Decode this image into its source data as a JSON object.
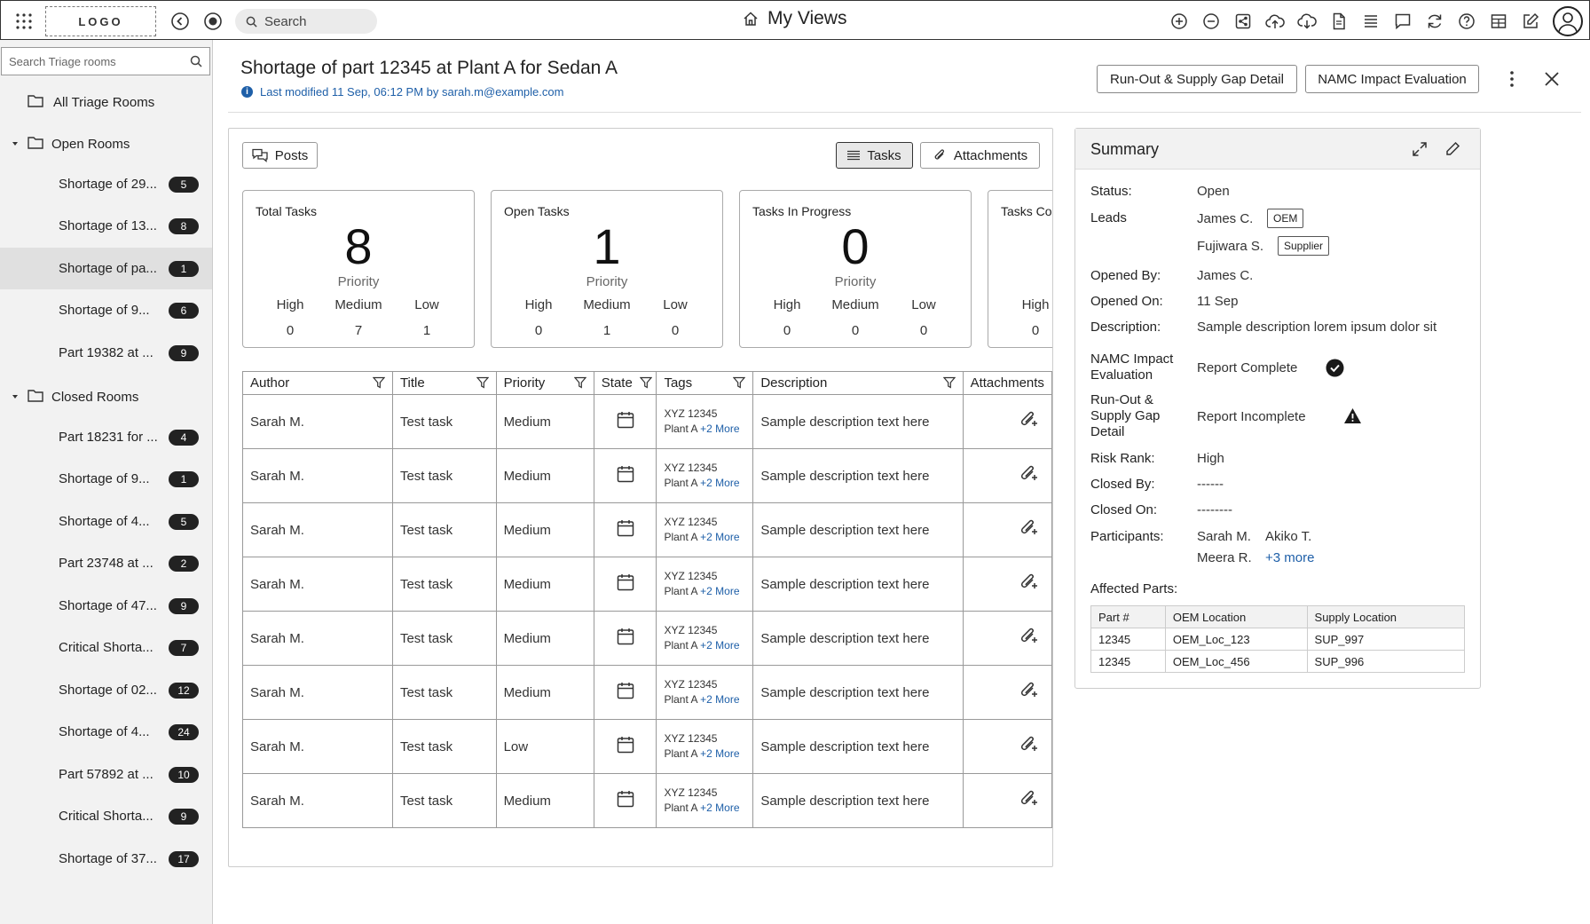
{
  "topbar": {
    "logo": "LOGO",
    "search_placeholder": "Search",
    "title": "My Views"
  },
  "sidebar": {
    "search_placeholder": "Search Triage rooms",
    "all_rooms": "All Triage Rooms",
    "open_group": "Open Rooms",
    "closed_group": "Closed Rooms",
    "open_items": [
      {
        "label": "Shortage of 29...",
        "count": "5"
      },
      {
        "label": "Shortage of 13...",
        "count": "8"
      },
      {
        "label": "Shortage of pa...",
        "count": "1"
      },
      {
        "label": "Shortage of 9...",
        "count": "6"
      },
      {
        "label": "Part 19382 at ...",
        "count": "9"
      }
    ],
    "closed_items": [
      {
        "label": "Part 18231 for ...",
        "count": "4"
      },
      {
        "label": "Shortage of 9...",
        "count": "1"
      },
      {
        "label": "Shortage of 4...",
        "count": "5"
      },
      {
        "label": "Part 23748 at ...",
        "count": "2"
      },
      {
        "label": "Shortage of 47...",
        "count": "9"
      },
      {
        "label": "Critical Shorta...",
        "count": "7"
      },
      {
        "label": "Shortage of 02...",
        "count": "12"
      },
      {
        "label": "Shortage of 4...",
        "count": "24"
      },
      {
        "label": "Part 57892 at ...",
        "count": "10"
      },
      {
        "label": "Critical Shorta...",
        "count": "9"
      },
      {
        "label": "Shortage of 37...",
        "count": "17"
      }
    ]
  },
  "header": {
    "title": "Shortage of part 12345 at Plant A for Sedan A",
    "modified": "Last modified 11 Sep, 06:12 PM by sarah.m@example.com",
    "btn_runout": "Run-Out & Supply Gap Detail",
    "btn_namc": "NAMC Impact Evaluation"
  },
  "main": {
    "posts": "Posts",
    "tab_tasks": "Tasks",
    "tab_attachments": "Attachments",
    "cards": [
      {
        "label": "Total Tasks",
        "value": "8",
        "priority": "Priority",
        "high": "0",
        "medium": "7",
        "low": "1"
      },
      {
        "label": "Open Tasks",
        "value": "1",
        "priority": "Priority",
        "high": "0",
        "medium": "1",
        "low": "0"
      },
      {
        "label": "Tasks In Progress",
        "value": "0",
        "priority": "Priority",
        "high": "0",
        "medium": "0",
        "low": "0"
      },
      {
        "label": "Tasks Completed",
        "value": "",
        "priority": "",
        "high": "0",
        "medium": "",
        "low": ""
      }
    ],
    "prio_labels": {
      "high": "High",
      "medium": "Medium",
      "low": "Low"
    },
    "columns": [
      "Author",
      "Title",
      "Priority",
      "State",
      "Tags",
      "Description",
      "Attachments"
    ],
    "rows": [
      {
        "author": "Sarah M.",
        "title": "Test task",
        "priority": "Medium",
        "tag1": "XYZ 12345",
        "tag2": "Plant A",
        "more": "+2 More",
        "desc": "Sample description text here"
      },
      {
        "author": "Sarah M.",
        "title": "Test task",
        "priority": "Medium",
        "tag1": "XYZ 12345",
        "tag2": "Plant A",
        "more": "+2 More",
        "desc": "Sample description text here"
      },
      {
        "author": "Sarah M.",
        "title": "Test task",
        "priority": "Medium",
        "tag1": "XYZ 12345",
        "tag2": "Plant A",
        "more": "+2 More",
        "desc": "Sample description text here"
      },
      {
        "author": "Sarah M.",
        "title": "Test task",
        "priority": "Medium",
        "tag1": "XYZ 12345",
        "tag2": "Plant A",
        "more": "+2 More",
        "desc": "Sample description text here"
      },
      {
        "author": "Sarah M.",
        "title": "Test task",
        "priority": "Medium",
        "tag1": "XYZ 12345",
        "tag2": "Plant A",
        "more": "+2 More",
        "desc": "Sample description text here"
      },
      {
        "author": "Sarah M.",
        "title": "Test task",
        "priority": "Medium",
        "tag1": "XYZ 12345",
        "tag2": "Plant A",
        "more": "+2 More",
        "desc": "Sample description text here"
      },
      {
        "author": "Sarah M.",
        "title": "Test task",
        "priority": "Low",
        "tag1": "XYZ 12345",
        "tag2": "Plant A",
        "more": "+2 More",
        "desc": "Sample description text here"
      },
      {
        "author": "Sarah M.",
        "title": "Test task",
        "priority": "Medium",
        "tag1": "XYZ 12345",
        "tag2": "Plant A",
        "more": "+2 More",
        "desc": "Sample description text here"
      }
    ]
  },
  "summary": {
    "title": "Summary",
    "status_k": "Status:",
    "status_v": "Open",
    "leads_k": "Leads",
    "lead1": "James C.",
    "lead1_tag": "OEM",
    "lead2": "Fujiwara S.",
    "lead2_tag": "Supplier",
    "opened_by_k": "Opened By:",
    "opened_by_v": "James C.",
    "opened_on_k": "Opened On:",
    "opened_on_v": "11 Sep",
    "desc_k": "Description:",
    "desc_v": "Sample description lorem ipsum dolor sit",
    "namc_k1": "NAMC Impact",
    "namc_k2": "Evaluation",
    "namc_v": "Report Complete",
    "runout_k1": "Run-Out &",
    "runout_k2": "Supply Gap",
    "runout_k3": "Detail",
    "runout_v": "Report Incomplete",
    "risk_k": "Risk Rank:",
    "risk_v": "High",
    "closed_by_k": "Closed By:",
    "closed_by_v": "------",
    "closed_on_k": "Closed On:",
    "closed_on_v": "--------",
    "participants_k": "Participants:",
    "p1": "Sarah M.",
    "p2": "Akiko T.",
    "p3": "Meera R.",
    "p_more": "+3 more",
    "affected_k": "Affected Parts:",
    "parts_cols": [
      "Part #",
      "OEM Location",
      "Supply Location"
    ],
    "parts_rows": [
      [
        "12345",
        "OEM_Loc_123",
        "SUP_997"
      ],
      [
        "12345",
        "OEM_Loc_456",
        "SUP_996"
      ]
    ]
  }
}
